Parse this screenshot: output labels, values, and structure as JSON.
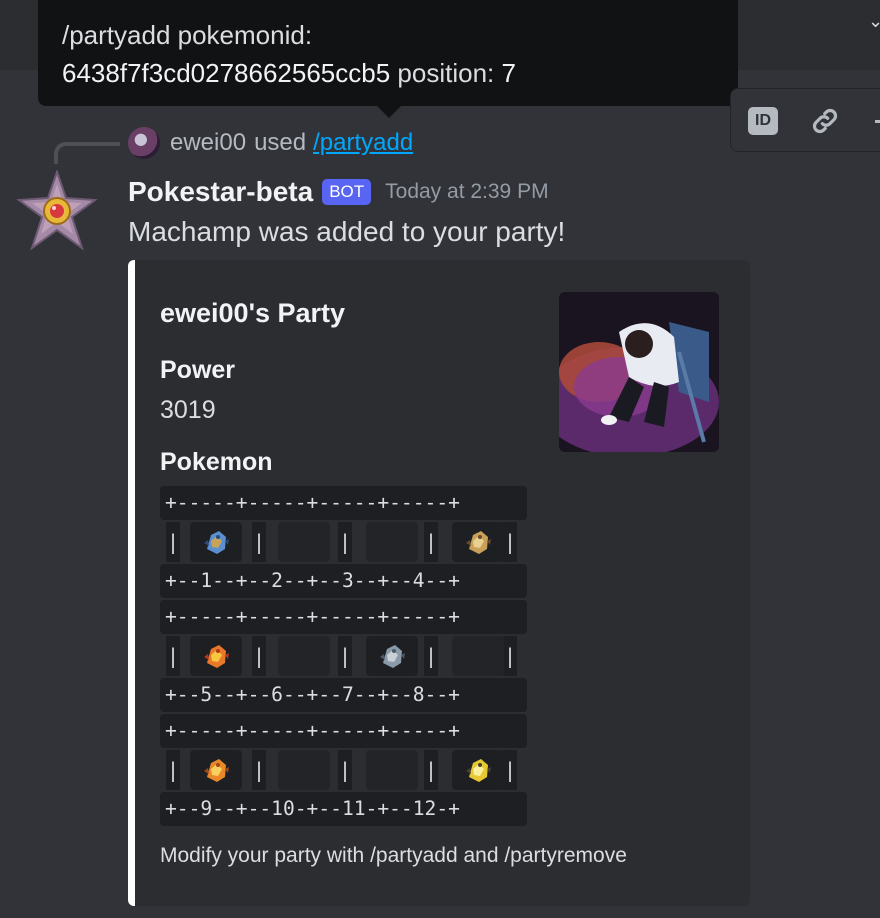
{
  "tooltip": {
    "line1": "/partyadd pokemonid:",
    "pokemonid": "6438f7f3cd0278662565ccb5",
    "position_label": " position: ",
    "position_value": "7"
  },
  "hover_toolbar": {
    "id_label": "ID"
  },
  "reply": {
    "user": "ewei00",
    "used": "used",
    "command": "/partyadd"
  },
  "message": {
    "author": "Pokestar-beta",
    "bot_tag": "BOT",
    "timestamp": "Today at 2:39 PM",
    "text": "Machamp was added to your party!"
  },
  "embed": {
    "title": "ewei00's Party",
    "field_power_name": "Power",
    "field_power_value": "3019",
    "field_pokemon_name": "Pokemon",
    "code": {
      "border": "+-----+-----+-----+-----+",
      "labels_row1": "+--1--+--2--+--3--+--4--+",
      "labels_row2": "+--5--+--6--+--7--+--8--+",
      "labels_row3": "+--9--+--10-+--11-+--12-+"
    },
    "footer": "Modify your party with /partyadd and /partyremove"
  },
  "party_slots": [
    {
      "slot": 1,
      "icon": "blastoise-sprite-icon"
    },
    {
      "slot": 2,
      "icon": "empty"
    },
    {
      "slot": 3,
      "icon": "empty"
    },
    {
      "slot": 4,
      "icon": "kabutops-sprite-icon"
    },
    {
      "slot": 5,
      "icon": "moltres-sprite-icon"
    },
    {
      "slot": 6,
      "icon": "empty"
    },
    {
      "slot": 7,
      "icon": "machamp-sprite-icon"
    },
    {
      "slot": 8,
      "icon": "empty"
    },
    {
      "slot": 9,
      "icon": "charizard-sprite-icon"
    },
    {
      "slot": 10,
      "icon": "empty"
    },
    {
      "slot": 11,
      "icon": "empty"
    },
    {
      "slot": 12,
      "icon": "zapdos-sprite-icon"
    }
  ],
  "colors": {
    "background": "#313338",
    "embed_bg": "#2b2d31",
    "embed_accent": "#ffffff",
    "bot_tag": "#5865f2",
    "link": "#00a8fc"
  }
}
